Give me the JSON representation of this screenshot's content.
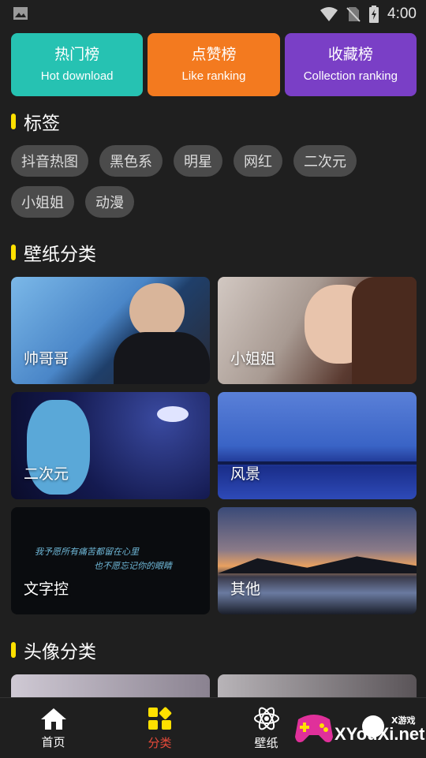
{
  "status": {
    "time": "4:00"
  },
  "ranking": [
    {
      "zh": "热门榜",
      "en": "Hot download",
      "color": "#26c2b2"
    },
    {
      "zh": "点赞榜",
      "en": "Like ranking",
      "color": "#f37a1f"
    },
    {
      "zh": "收藏榜",
      "en": "Collection ranking",
      "color": "#7a3fc6"
    }
  ],
  "sections": {
    "tags": "标签",
    "wallpaper": "壁纸分类",
    "avatar": "头像分类"
  },
  "tags": [
    "抖音热图",
    "黑色系",
    "明星",
    "网红",
    "二次元",
    "小姐姐",
    "动漫"
  ],
  "wallpaper_categories": [
    "帅哥哥",
    "小姐姐",
    "二次元",
    "风景",
    "文字控",
    "其他"
  ],
  "text_card_lines": [
    "我予愿所有痛苦都留在心里",
    "也不愿忘记你的眼睛"
  ],
  "nav": [
    {
      "label": "首页",
      "icon": "home-icon"
    },
    {
      "label": "分类",
      "icon": "category-icon"
    },
    {
      "label": "壁纸",
      "icon": "atom-icon"
    },
    {
      "label": "",
      "icon": "profile-icon"
    }
  ],
  "colors": {
    "accent_yellow": "#ffe000",
    "active_nav": "#e84a3a"
  },
  "watermark": {
    "small": "X游戏",
    "big": "XYouXi.net"
  }
}
